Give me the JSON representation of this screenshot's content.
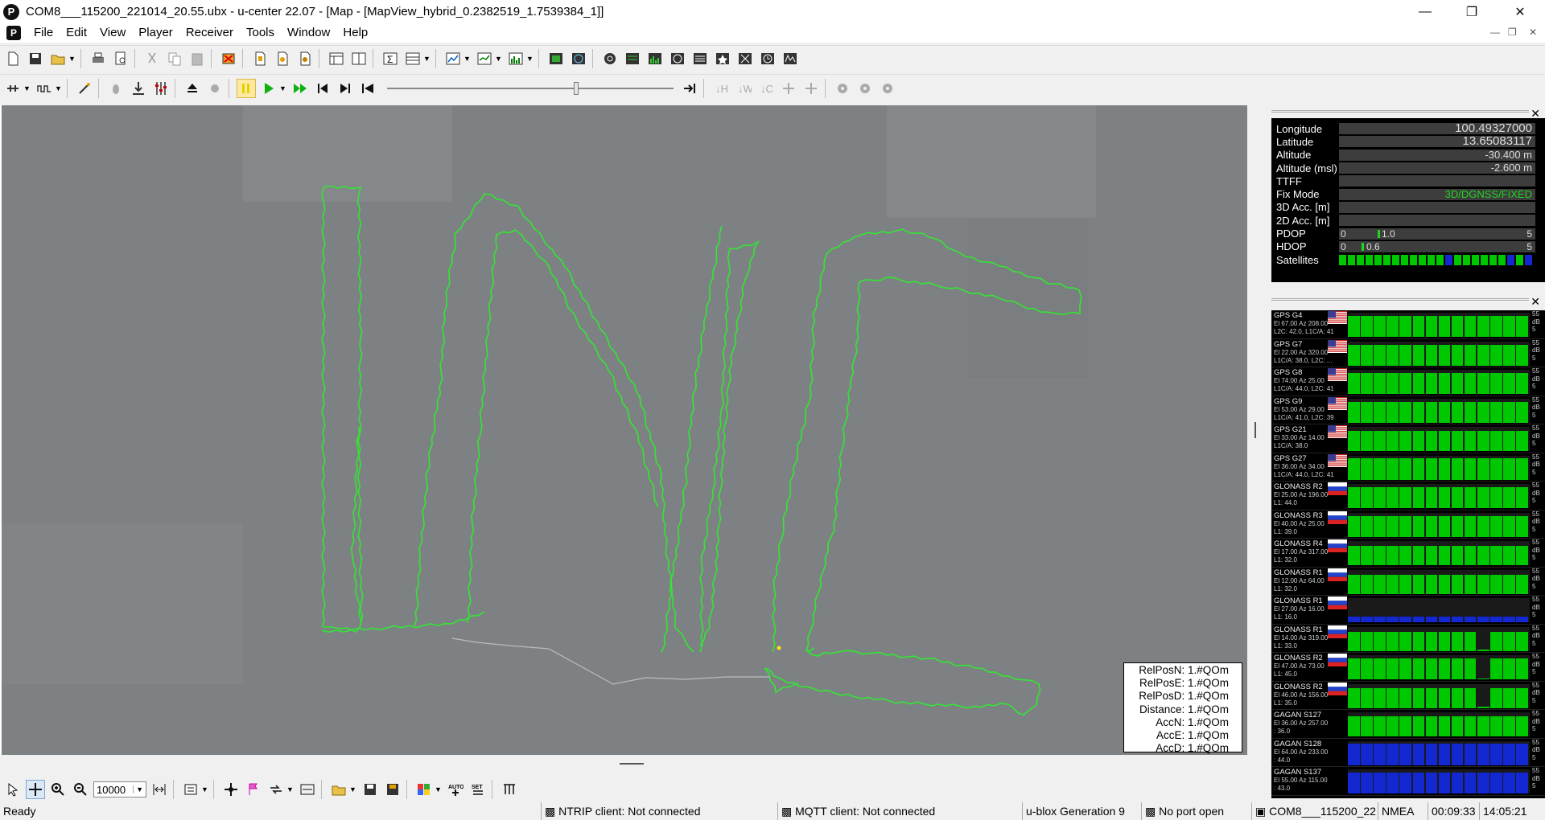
{
  "window": {
    "title": "COM8___115200_221014_20.55.ubx - u-center 22.07 - [Map - [MapView_hybrid_0.2382519_1.7539384_1]]",
    "app_icon_letter": "P"
  },
  "menu": {
    "items": [
      "File",
      "Edit",
      "View",
      "Player",
      "Receiver",
      "Tools",
      "Window",
      "Help"
    ]
  },
  "data_view": {
    "longitude_label": "Longitude",
    "longitude_value": "100.49327000",
    "latitude_label": "Latitude",
    "latitude_value": "13.65083117",
    "altitude_label": "Altitude",
    "altitude_value": "-30.400 m",
    "altitude_msl_label": "Altitude (msl)",
    "altitude_msl_value": "-2.600 m",
    "ttff_label": "TTFF",
    "ttff_value": "",
    "fix_mode_label": "Fix Mode",
    "fix_mode_value": "3D/DGNSS/FIXED",
    "acc3d_label": "3D Acc. [m]",
    "acc2d_label": "2D Acc. [m]",
    "pdop_label": "PDOP",
    "pdop_min": "0",
    "pdop_value": "1.0",
    "pdop_max": "5",
    "hdop_label": "HDOP",
    "hdop_min": "0",
    "hdop_value": "0.6",
    "hdop_max": "5",
    "satellites_label": "Satellites",
    "satellite_cells": [
      "g",
      "g",
      "g",
      "g",
      "g",
      "g",
      "g",
      "g",
      "g",
      "g",
      "g",
      "g",
      "b",
      "g",
      "g",
      "g",
      "g",
      "g",
      "g",
      "b",
      "g",
      "b"
    ]
  },
  "relpos": {
    "lines": [
      "RelPosN: 1.#QOm",
      "RelPosE: 1.#QOm",
      "RelPosD: 1.#QOm",
      "Distance: 1.#QOm",
      "AccN: 1.#QOm",
      "AccE: 1.#QOm",
      "AccD: 1.#QOm"
    ]
  },
  "map_toolbar": {
    "zoom_value": "10000"
  },
  "satellites": [
    {
      "name": "GPS G4",
      "info1": "El 67.00 Az 208.00",
      "info2": "L2C: 42.0, L1C/A: 41",
      "flag": "us",
      "strength": 0.88
    },
    {
      "name": "GPS G7",
      "info1": "El 22.00 Az 320.00",
      "info2": "L1C/A: 38.0, L2C: ...",
      "flag": "us",
      "strength": 0.86
    },
    {
      "name": "GPS G8",
      "info1": "El 74.00 Az 25.00",
      "info2": "L1C/A: 44.0, L2C: 41",
      "flag": "us",
      "strength": 0.87
    },
    {
      "name": "GPS G9",
      "info1": "El 53.00 Az 29.00",
      "info2": "L1C/A: 41.0, L2C: 39",
      "flag": "us",
      "strength": 0.86
    },
    {
      "name": "GPS G21",
      "info1": "El 33.00 Az 14.00",
      "info2": "L1C/A: 38.0",
      "flag": "us",
      "strength": 0.82
    },
    {
      "name": "GPS G27",
      "info1": "El 36.00 Az 34.00",
      "info2": "L1C/A: 44.0, L2C: 41",
      "flag": "us",
      "strength": 0.88
    },
    {
      "name": "GLONASS R2",
      "info1": "El 25.00 Az 196.00",
      "info2": "L1: 44.0",
      "flag": "ru",
      "strength": 0.87
    },
    {
      "name": "GLONASS R3",
      "info1": "El 40.00 Az 25.00",
      "info2": "L1: 39.0",
      "flag": "ru",
      "strength": 0.85
    },
    {
      "name": "GLONASS R4",
      "info1": "El 17.00 Az 317.00",
      "info2": "L1: 32.0",
      "flag": "ru",
      "strength": 0.8
    },
    {
      "name": "GLONASS R1",
      "info1": "El 12.00 Az 64.00",
      "info2": "L1: 32.0",
      "flag": "ru",
      "strength": 0.8
    },
    {
      "name": "GLONASS R1",
      "info1": "El 27.00 Az 16.00",
      "info2": "L1: 16.0",
      "flag": "ru",
      "strength": 0.25
    },
    {
      "name": "GLONASS R1",
      "info1": "El 14.00 Az 319.00",
      "info2": "L1: 33.0",
      "flag": "ru",
      "strength": 0.8
    },
    {
      "name": "GLONASS R2",
      "info1": "El 47.00 Az 73.00",
      "info2": "L1: 45.0",
      "flag": "ru",
      "strength": 0.88
    },
    {
      "name": "GLONASS R2",
      "info1": "El 46.00 Az 156.00",
      "info2": "L1: 35.0",
      "flag": "ru",
      "strength": 0.82
    },
    {
      "name": "GAGAN S127",
      "info1": "El 36.00 Az 257.00",
      "info2": ": 36.0",
      "flag": "",
      "strength": 0.84
    },
    {
      "name": "GAGAN S128",
      "info1": "El 64.00 Az 233.00",
      "info2": ": 44.0",
      "flag": "",
      "strength": 0.88
    },
    {
      "name": "GAGAN S137",
      "info1": "El 55.00 Az 115.00",
      "info2": ": 43.0",
      "flag": "",
      "strength": 0.87
    }
  ],
  "sat_scale": {
    "top": "55",
    "unit": "dB",
    "bottom": "5"
  },
  "statusbar": {
    "ready": "Ready",
    "ntrip": "NTRIP client: Not connected",
    "mqtt": "MQTT client: Not connected",
    "generation": "u-blox Generation 9",
    "port": "No port open",
    "file": "COM8___115200_22",
    "protocol": "NMEA",
    "elapsed": "00:09:33",
    "clock": "14:05:21"
  },
  "colors": {
    "track": "#32e632",
    "map_bg": "#808285",
    "bar_green": "#00c800",
    "bar_blue": "#1428d2"
  }
}
